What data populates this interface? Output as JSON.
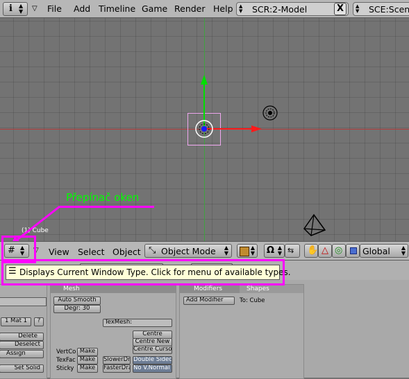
{
  "topbar": {
    "menus": [
      "File",
      "Add",
      "Timeline",
      "Game",
      "Render",
      "Help"
    ],
    "screen_field": "SCR:2-Model",
    "scene_field": "SCE:Scen",
    "close_label": "X"
  },
  "viewport": {
    "object_label": "(1) Cube",
    "annotation": "Přepínač oken"
  },
  "viewheader": {
    "menus": [
      "View",
      "Select",
      "Object"
    ],
    "mode": "Object Mode",
    "orientation": "Global"
  },
  "tooltip": {
    "text": "Displays Current Window Type. Click for menu of available types."
  },
  "buttons": {
    "link_panel": {
      "mat_label": "1 Mat 1",
      "mat_btn": "?",
      "delete": "Delete",
      "deselect": "Deselect",
      "assign": "Assign",
      "set_solid": "Set Solid"
    },
    "mesh_panel": {
      "title": "Mesh",
      "auto_smooth": "Auto Smooth",
      "degr": "Degr: 30",
      "texmesh": "TexMesh:",
      "centre": "Centre",
      "centre_new": "Centre New",
      "centre_cursor": "Centre Cursor",
      "vertco": "VertCo",
      "texfac": "TexFac",
      "sticky": "Sticky",
      "make": "Make",
      "slower": "SlowerDr",
      "faster": "FasterDra",
      "double_sided": "Double Sided",
      "no_vnormal": "No V.Normal F"
    },
    "modifiers_panel": {
      "tab_modifiers": "Modifiers",
      "tab_shapes": "Shapes",
      "add_modifier": "Add Modifier",
      "to_cube": "To: Cube"
    }
  },
  "colors": {
    "annotation": "#00ff00",
    "highlight": "#ff00ff",
    "axis_x": "#ff0000",
    "axis_y": "#00c000",
    "tooltip_bg": "#ffffd8"
  }
}
